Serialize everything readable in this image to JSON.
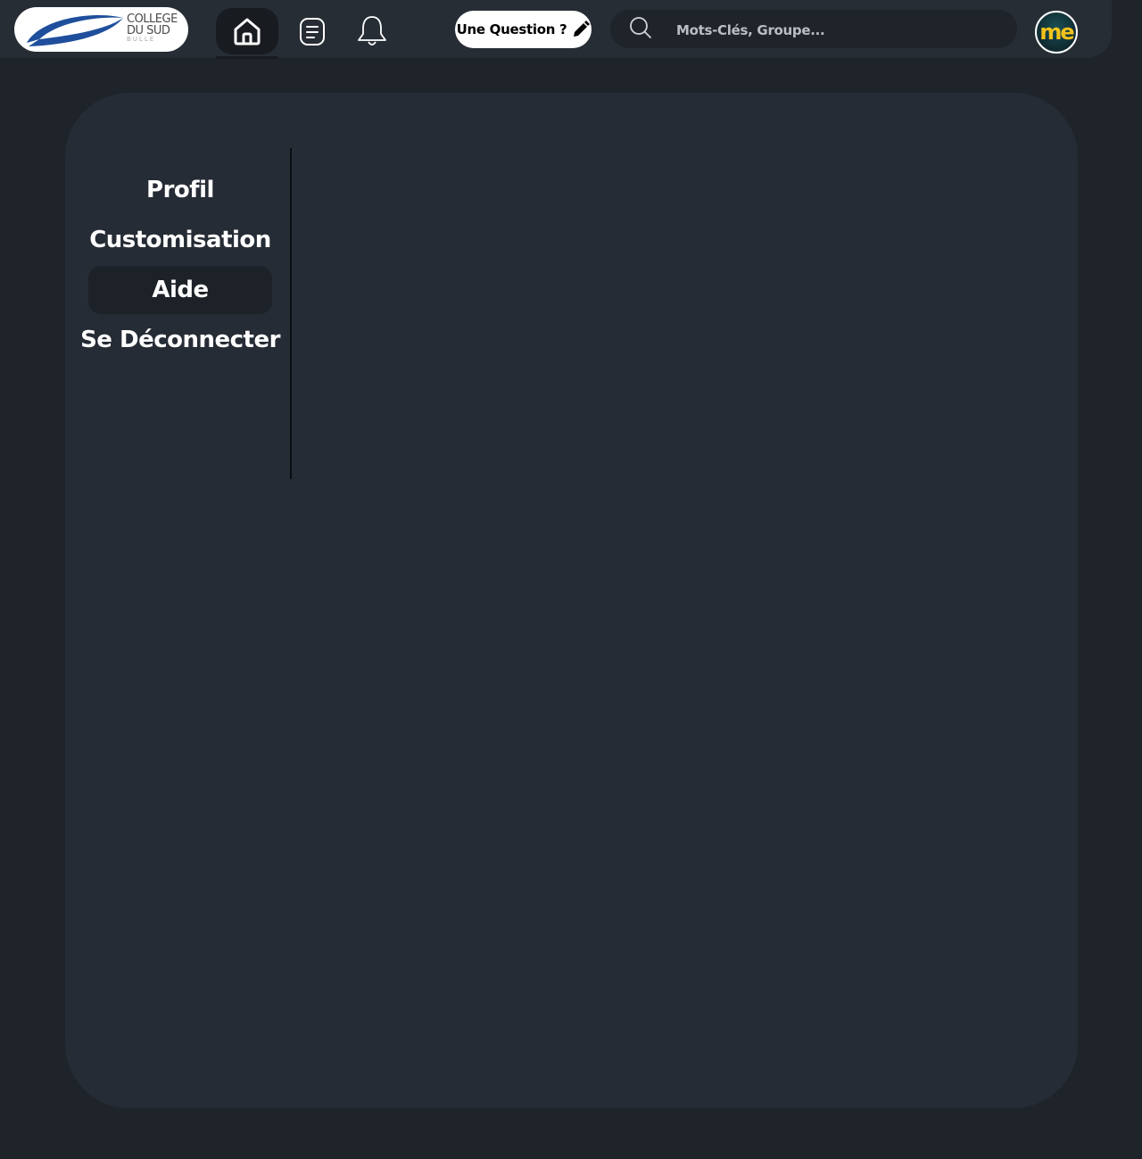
{
  "header": {
    "logo": {
      "line1": "COLLEGE",
      "line2": "DU SUD",
      "line3": "BULLE"
    },
    "nav": [
      {
        "name": "home",
        "icon": "home-icon",
        "active": true
      },
      {
        "name": "posts",
        "icon": "list-icon",
        "active": false
      },
      {
        "name": "notifications",
        "icon": "bell-icon",
        "active": false
      }
    ],
    "ask_button": {
      "label": "Une Question ?",
      "icon": "pencil-icon"
    },
    "search": {
      "placeholder": "Mots-Clés, Groupe...",
      "value": "",
      "icon": "search-icon"
    },
    "avatar": {
      "text": "me",
      "color": "#f2c21b"
    }
  },
  "sidebar": {
    "items": [
      {
        "label": "Profil",
        "active": false
      },
      {
        "label": "Customisation",
        "active": false
      },
      {
        "label": "Aide",
        "active": true
      },
      {
        "label": "Se Déconnecter",
        "active": false
      }
    ]
  },
  "colors": {
    "page_bg": "#1f242b",
    "panel_bg": "#262c35",
    "active_item_bg": "#1d2228",
    "logo_blue": "#1f4f9c"
  }
}
